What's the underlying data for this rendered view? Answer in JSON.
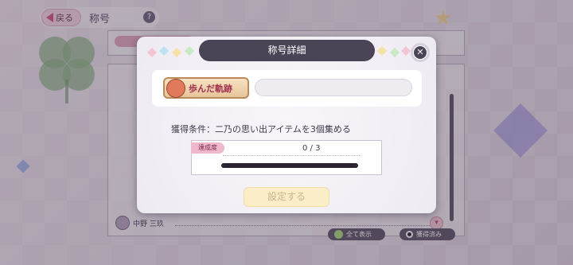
{
  "header": {
    "back_label": "戻る",
    "page_title": "称号",
    "help_label": "?"
  },
  "modal": {
    "title": "称号詳細",
    "close_label": "✕",
    "badge_text": "歩んだ軌跡",
    "title_name_value": "",
    "condition_text": "獲得条件：二乃の思い出アイテムを3個集める",
    "progress": {
      "tag_label": "達成度",
      "count_text": "0 / 3",
      "value": 0,
      "max": 3
    },
    "set_button_label": "設定する"
  },
  "list": {
    "owner_name": "中野 三玖",
    "show_all_label": "全て表示",
    "owned_label": "獲得済み"
  },
  "colors": {
    "accent_pink": "#e76a98",
    "header_dark": "#4b4456",
    "set_button_disabled": "#faedc7"
  },
  "icons": {
    "back": "back-arrow-icon",
    "help": "help-icon",
    "close": "close-icon",
    "expand": "chevron-down-icon",
    "show_all": "check-icon",
    "owned": "radio-icon"
  }
}
